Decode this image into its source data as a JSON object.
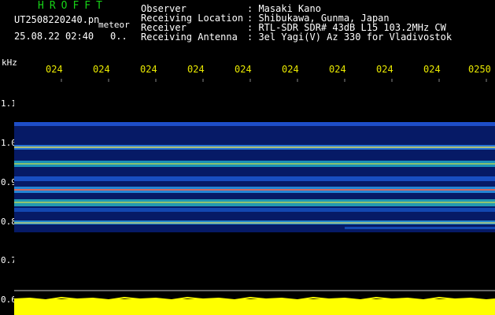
{
  "header": {
    "title": "HROFFT",
    "filename": "UT2508220240.pn",
    "filetype": "meteor",
    "datetime": "25.08.22 02:40",
    "count": "0.."
  },
  "info": [
    {
      "key": "Observer",
      "value": ": Masaki Kano"
    },
    {
      "key": "Receiving Location",
      "value": ": Shibukawa, Gunma, Japan"
    },
    {
      "key": "Receiver",
      "value": ": RTL-SDR SDR# 43dB L15 103.2MHz CW"
    },
    {
      "key": "Receiving Antenna",
      "value": ": 3el Yagi(V) Az 330 for Vladivostok"
    }
  ],
  "axis": {
    "y_unit": "kHz",
    "y_ticks": [
      "1.1",
      "1.0",
      "0.9",
      "0.8",
      "0.7",
      "0.6"
    ],
    "x_ticks": [
      "024",
      "024",
      "024",
      "024",
      "024",
      "024",
      "024",
      "024",
      "024",
      "0250"
    ]
  },
  "colors": {
    "background": "#000000",
    "label_green": "#17d317",
    "tick_yellow": "#e8e800",
    "power_yellow": "#ffff00",
    "noise_blue": "#0a2a9a"
  }
}
